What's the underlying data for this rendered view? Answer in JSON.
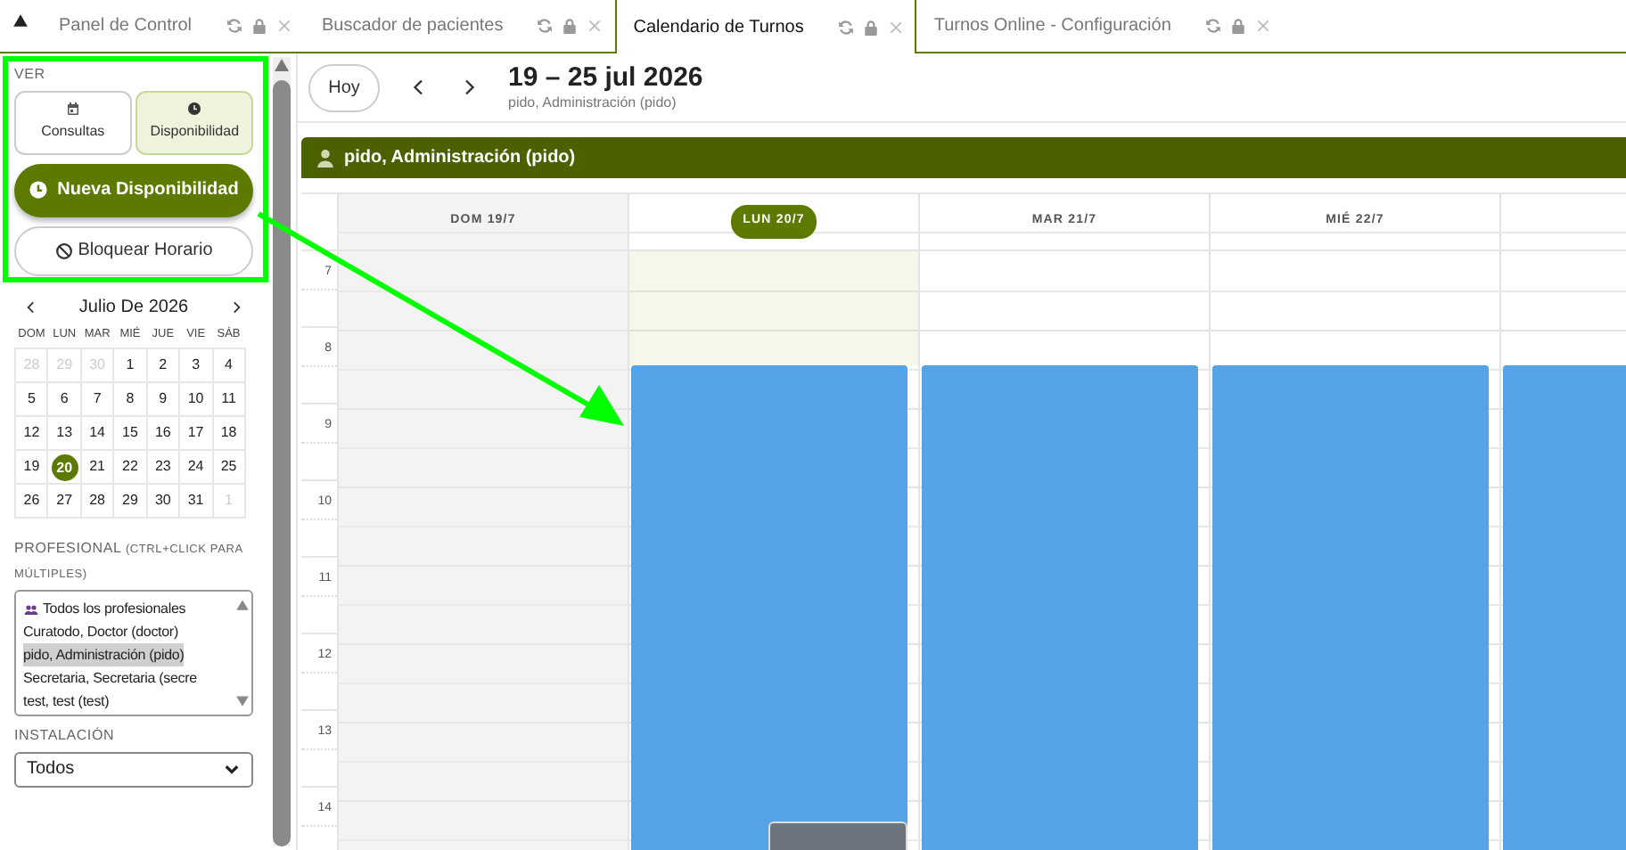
{
  "tabs": [
    {
      "label": "Panel de Control",
      "selected": false
    },
    {
      "label": "Buscador de pacientes",
      "selected": false
    },
    {
      "label": "Calendario de Turnos",
      "selected": true
    },
    {
      "label": "Turnos Online - Configuración",
      "selected": false
    }
  ],
  "sidebar": {
    "view_label": "VER",
    "view_buttons": [
      {
        "label": "Consultas",
        "kind": "calendar",
        "selected": false
      },
      {
        "label": "Disponibilidad",
        "kind": "clock",
        "selected": true
      }
    ],
    "new_button": "Nueva Disponibilidad",
    "block_button": "Bloquear Horario",
    "month": {
      "title": "Julio De 2026",
      "weekdays": [
        "DOM",
        "LUN",
        "MAR",
        "MIÉ",
        "JUE",
        "VIE",
        "SÁB"
      ],
      "weeks": [
        [
          {
            "day": "28",
            "muted": true,
            "selected": false
          },
          {
            "day": "29",
            "muted": true,
            "selected": false
          },
          {
            "day": "30",
            "muted": true,
            "selected": false
          },
          {
            "day": "1",
            "muted": false,
            "selected": false
          },
          {
            "day": "2",
            "muted": false,
            "selected": false
          },
          {
            "day": "3",
            "muted": false,
            "selected": false
          },
          {
            "day": "4",
            "muted": false,
            "selected": false
          }
        ],
        [
          {
            "day": "5",
            "muted": false,
            "selected": false
          },
          {
            "day": "6",
            "muted": false,
            "selected": false
          },
          {
            "day": "7",
            "muted": false,
            "selected": false
          },
          {
            "day": "8",
            "muted": false,
            "selected": false
          },
          {
            "day": "9",
            "muted": false,
            "selected": false
          },
          {
            "day": "10",
            "muted": false,
            "selected": false
          },
          {
            "day": "11",
            "muted": false,
            "selected": false
          }
        ],
        [
          {
            "day": "12",
            "muted": false,
            "selected": false
          },
          {
            "day": "13",
            "muted": false,
            "selected": false
          },
          {
            "day": "14",
            "muted": false,
            "selected": false
          },
          {
            "day": "15",
            "muted": false,
            "selected": false
          },
          {
            "day": "16",
            "muted": false,
            "selected": false
          },
          {
            "day": "17",
            "muted": false,
            "selected": false
          },
          {
            "day": "18",
            "muted": false,
            "selected": false
          }
        ],
        [
          {
            "day": "19",
            "muted": false,
            "selected": false
          },
          {
            "day": "20",
            "muted": false,
            "selected": true
          },
          {
            "day": "21",
            "muted": false,
            "selected": false
          },
          {
            "day": "22",
            "muted": false,
            "selected": false
          },
          {
            "day": "23",
            "muted": false,
            "selected": false
          },
          {
            "day": "24",
            "muted": false,
            "selected": false
          },
          {
            "day": "25",
            "muted": false,
            "selected": false
          }
        ],
        [
          {
            "day": "26",
            "muted": false,
            "selected": false
          },
          {
            "day": "27",
            "muted": false,
            "selected": false
          },
          {
            "day": "28",
            "muted": false,
            "selected": false
          },
          {
            "day": "29",
            "muted": false,
            "selected": false
          },
          {
            "day": "30",
            "muted": false,
            "selected": false
          },
          {
            "day": "31",
            "muted": false,
            "selected": false
          },
          {
            "day": "1",
            "muted": true,
            "selected": false
          }
        ]
      ]
    },
    "professional_label": "PROFESIONAL",
    "professional_hint": "(CTRL+CLICK PARA MÚLTIPLES)",
    "professionals": [
      {
        "label": "Todos los profesionales",
        "kind": "group",
        "selected": false
      },
      {
        "label": "Curatodo, Doctor (doctor)",
        "kind": "person",
        "selected": false
      },
      {
        "label": "pido, Administración (pido)",
        "kind": "person",
        "selected": true
      },
      {
        "label": "Secretaria, Secretaria (secre",
        "kind": "person",
        "selected": false
      },
      {
        "label": "test, test (test)",
        "kind": "person",
        "selected": false
      }
    ],
    "installation_label": "INSTALACIÓN",
    "installation_value": "Todos"
  },
  "toolbar": {
    "today_button": "Hoy",
    "title": "19 – 25 jul 2026",
    "subtitle": "pido, Administración (pido)"
  },
  "resource": "pido, Administración (pido)",
  "hours": [
    "7",
    "8",
    "9",
    "10",
    "11",
    "12",
    "13",
    "14"
  ],
  "days": [
    {
      "label": "DOM 19/7",
      "selected": false,
      "weekend": true
    },
    {
      "label": "LUN 20/7",
      "selected": true,
      "weekend": false,
      "events": [
        {
          "kind": "available"
        },
        {
          "kind": "busy"
        }
      ]
    },
    {
      "label": "MAR 21/7",
      "selected": false,
      "weekend": false,
      "events": [
        {
          "kind": "available"
        }
      ]
    },
    {
      "label": "MIÉ 22/7",
      "selected": false,
      "weekend": false,
      "events": [
        {
          "kind": "available"
        }
      ]
    },
    {
      "selected": false,
      "weekend": false,
      "events": [
        {
          "kind": "available"
        }
      ]
    }
  ]
}
